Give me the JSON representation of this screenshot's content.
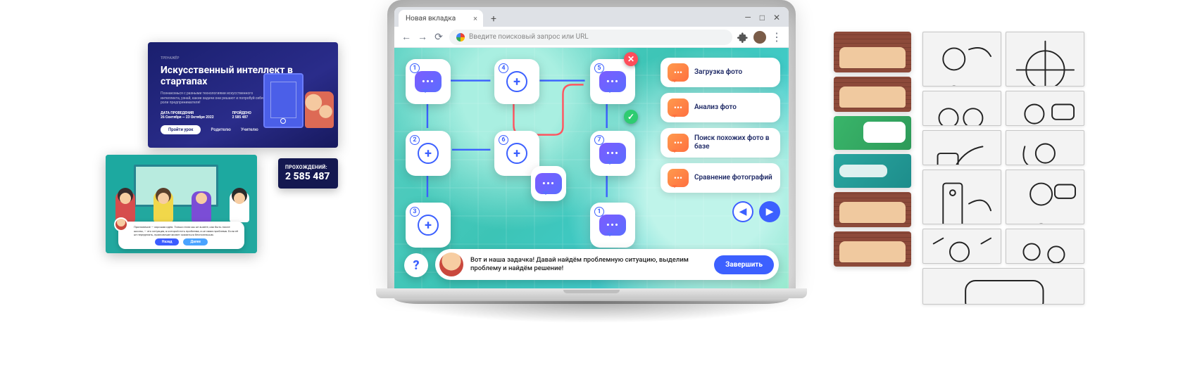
{
  "browser": {
    "tab_title": "Новая вкладка",
    "new_tab": "+",
    "window_min": "—",
    "window_max": "□",
    "window_close": "✕",
    "omnibox_placeholder": "Введите поисковый запрос или URL"
  },
  "hero": {
    "tag": "ТРЕНАЖЁР",
    "title": "Искусственный интеллект в стартапах",
    "blurb": "Познакомься с разными технологиями искусственного интеллекта, узнай, какие задачи они решают и попробуй себя в роли предпринимателя!",
    "date_label1": "ДАТА ПРОВЕДЕНИЯ",
    "date_val1": "26 Сентября — 23 Октября 2022",
    "date_label2": "ПРОЙДЕНО",
    "date_val2": "2 585 487",
    "cta_primary": "Пройти урок",
    "cta_ghost1": "Родителю",
    "cta_ghost2": "Учителю"
  },
  "classroom": {
    "bubble_text": "Приложение — хорошая идея. Только если вы не знаете, как быть после школы, — это ситуация, в которой есть проблема, а не сама проблема. Если её не переделать, приложение может оказаться бесполезным.",
    "btn_back": "Назад",
    "btn_next": "Далее"
  },
  "counter": {
    "label": "ПРОХОЖДЕНИЙ:",
    "value": "2 585 487"
  },
  "game": {
    "options": [
      "Загрузка фото",
      "Анализ фото",
      "Поиск похожих фото в базе",
      "Сравнение фотографий"
    ],
    "nav_prev": "◀",
    "nav_next": "▶",
    "help": "?",
    "prompt": "Вот и наша задачка! Давай найдём проблемную ситуацию, выделим проблему и найдём решение!",
    "finish": "Завершить",
    "nodes": {
      "1": "1",
      "2": "2",
      "3": "3",
      "4": "4",
      "5": "5",
      "6": "6",
      "7": "7"
    },
    "marker_bad": "✕",
    "marker_good": "✓"
  }
}
